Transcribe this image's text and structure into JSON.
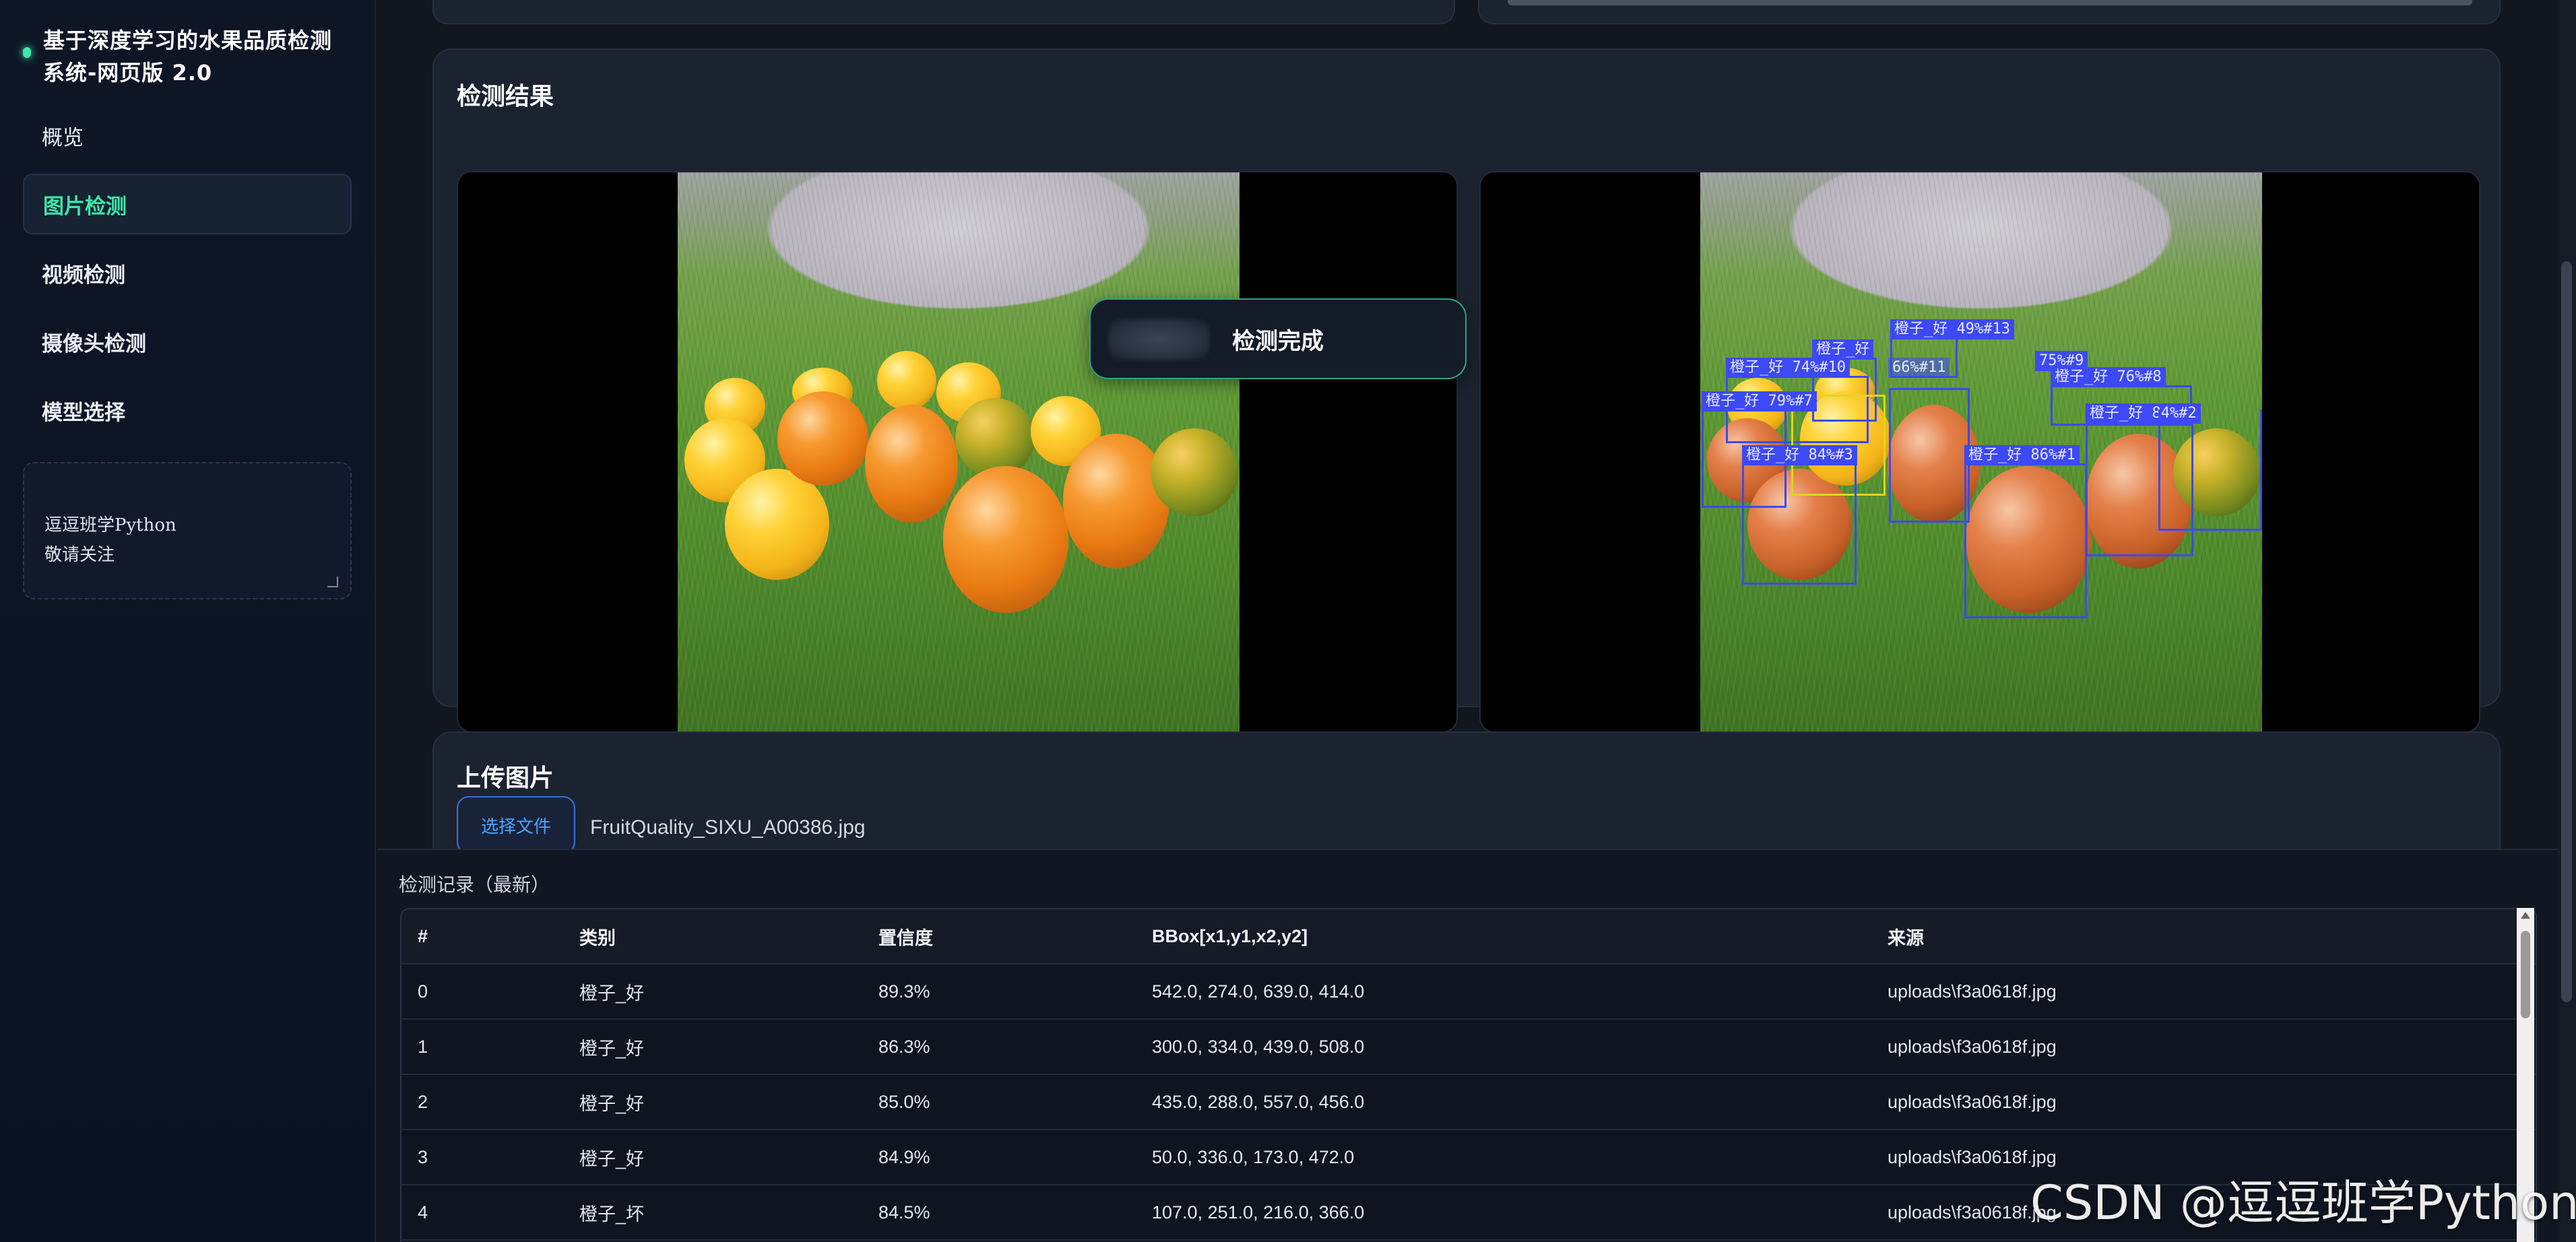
{
  "sidebar": {
    "brand_title": "基于深度学习的水果品质检测系统-网页版 2.0",
    "items": [
      {
        "label": "概览"
      },
      {
        "label": "图片检测"
      },
      {
        "label": "视频检测"
      },
      {
        "label": "摄像头检测"
      },
      {
        "label": "模型选择"
      }
    ],
    "note": "逗逗班学Python\n敬请关注"
  },
  "results": {
    "title": "检测结果",
    "toast": "检测完成",
    "detections": [
      {
        "label": "橙子_好 49%#13"
      },
      {
        "label": "橙子_好"
      },
      {
        "label": "66%#11"
      },
      {
        "label": "75%#9"
      },
      {
        "label": "橙子_好 74%#10"
      },
      {
        "label": "橙子_好 76%#8"
      },
      {
        "label": "橙子_好 79%#7"
      },
      {
        "label": "橙子_好 84%#2"
      },
      {
        "label": "橙子_好 84%#3"
      },
      {
        "label": "橙子_好 86%#1"
      }
    ]
  },
  "upload": {
    "title": "上传图片",
    "button": "选择文件",
    "filename": "FruitQuality_SIXU_A00386.jpg"
  },
  "records": {
    "title": "检测记录（最新）",
    "columns": [
      "#",
      "类别",
      "置信度",
      "BBox[x1,y1,x2,y2]",
      "来源"
    ],
    "rows": [
      [
        "0",
        "橙子_好",
        "89.3%",
        "542.0, 274.0, 639.0, 414.0",
        "uploads\\f3a0618f.jpg"
      ],
      [
        "1",
        "橙子_好",
        "86.3%",
        "300.0, 334.0, 439.0, 508.0",
        "uploads\\f3a0618f.jpg"
      ],
      [
        "2",
        "橙子_好",
        "85.0%",
        "435.0, 288.0, 557.0, 456.0",
        "uploads\\f3a0618f.jpg"
      ],
      [
        "3",
        "橙子_好",
        "84.9%",
        "50.0, 336.0, 173.0, 472.0",
        "uploads\\f3a0618f.jpg"
      ],
      [
        "4",
        "橙子_坏",
        "84.5%",
        "107.0, 251.0, 216.0, 366.0",
        "uploads\\f3a0618f.jpg"
      ]
    ]
  },
  "watermark": "CSDN @逗逗班学Python",
  "colors": {
    "accent": "#3ee6a8",
    "detection_box": "#3d49f5",
    "link_blue": "#4fa3ff"
  }
}
